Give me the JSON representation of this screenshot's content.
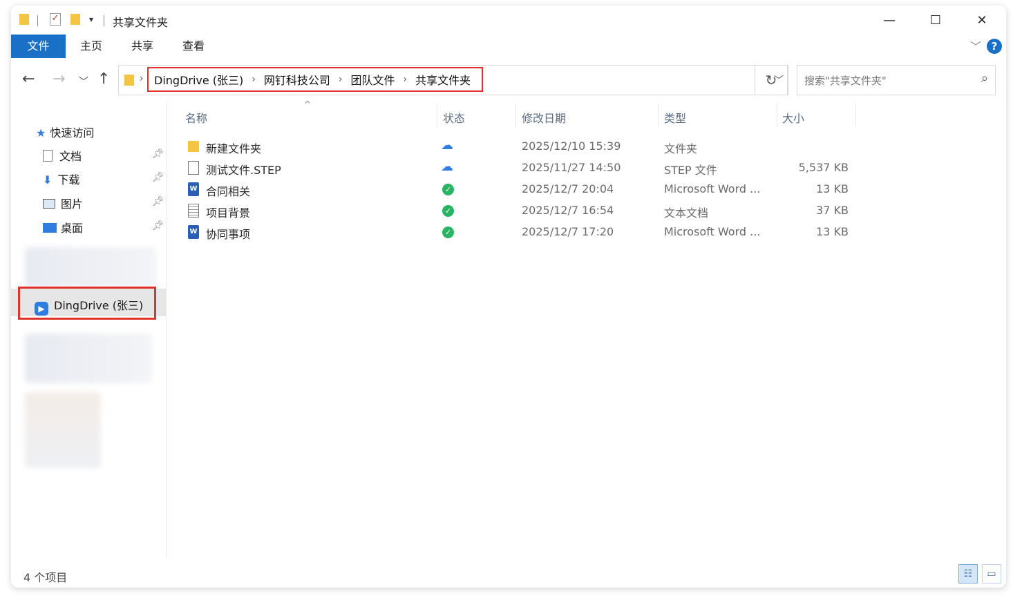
{
  "window": {
    "title": "共享文件夹",
    "qat_dropdown": "▾",
    "minimize": "—",
    "maximize": "☐",
    "close": "✕"
  },
  "ribbon": {
    "tabs": [
      {
        "label": "文件",
        "active": true
      },
      {
        "label": "主页"
      },
      {
        "label": "共享"
      },
      {
        "label": "查看"
      }
    ],
    "help": "?"
  },
  "address": {
    "breadcrumbs": [
      "DingDrive (张三)",
      "网钉科技公司",
      "团队文件",
      "共享文件夹"
    ],
    "search_placeholder": "搜索\"共享文件夹\""
  },
  "sidebar": {
    "quick_access": "快速访问",
    "pinned": [
      {
        "label": "文档",
        "icon": "document-icon"
      },
      {
        "label": "下载",
        "icon": "download-icon"
      },
      {
        "label": "图片",
        "icon": "pictures-icon"
      },
      {
        "label": "桌面",
        "icon": "desktop-icon"
      }
    ],
    "dingdrive": "DingDrive (张三)"
  },
  "columns": {
    "name": "名称",
    "status": "状态",
    "modified": "修改日期",
    "type": "类型",
    "size": "大小"
  },
  "files": [
    {
      "name": "新建文件夹",
      "icon": "folder-icon",
      "status": "cloud",
      "modified": "2025/12/10 15:39",
      "type": "文件夹",
      "size": ""
    },
    {
      "name": "测试文件.STEP",
      "icon": "file-icon",
      "status": "cloud",
      "modified": "2025/11/27 14:50",
      "type": "STEP 文件",
      "size": "5,537 KB"
    },
    {
      "name": "合同相关",
      "icon": "word-icon",
      "status": "synced",
      "modified": "2025/12/7 20:04",
      "type": "Microsoft Word ...",
      "size": "13 KB"
    },
    {
      "name": "项目背景",
      "icon": "text-icon",
      "status": "synced",
      "modified": "2025/12/7 16:54",
      "type": "文本文档",
      "size": "37 KB"
    },
    {
      "name": "协同事项",
      "icon": "word-icon",
      "status": "synced",
      "modified": "2025/12/7 17:20",
      "type": "Microsoft Word ...",
      "size": "13 KB"
    }
  ],
  "statusbar": {
    "count": "4 个项目"
  },
  "colors": {
    "accent": "#1a6fc7",
    "highlight_border": "#e0322b",
    "synced": "#28b463",
    "cloud": "#2f7de1"
  }
}
